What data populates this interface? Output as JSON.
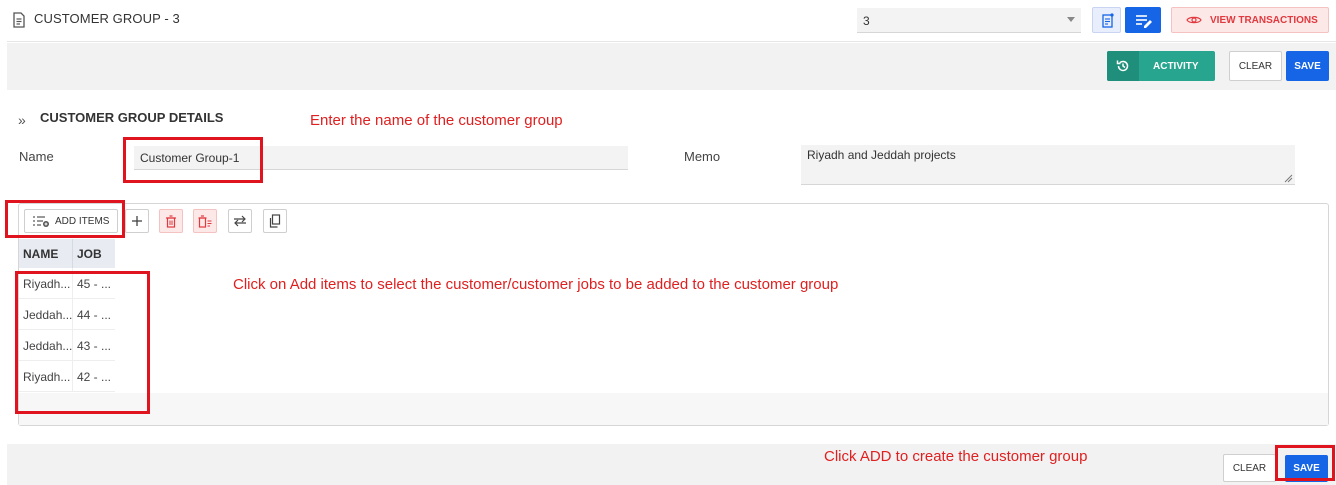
{
  "header": {
    "title": "CUSTOMER GROUP - 3",
    "record_select_value": "3",
    "view_transactions_label": "VIEW TRANSACTIONS"
  },
  "actions": {
    "activity_label": "ACTIVITY",
    "clear_label": "CLEAR",
    "save_label": "SAVE"
  },
  "section": {
    "title": "CUSTOMER GROUP DETAILS",
    "name_label": "Name",
    "name_value": "Customer Group-1",
    "memo_label": "Memo",
    "memo_value": "Riyadh and Jeddah projects"
  },
  "grid": {
    "add_items_label": "ADD ITEMS",
    "columns": [
      "NAME",
      "JOB"
    ],
    "rows": [
      [
        "Riyadh...",
        "45 - ..."
      ],
      [
        "Jeddah...",
        "44 - ..."
      ],
      [
        "Jeddah...",
        "43 - ..."
      ],
      [
        "Riyadh...",
        "42 - ..."
      ]
    ]
  },
  "footer": {
    "clear_label": "CLEAR",
    "save_label": "SAVE"
  },
  "annotations": {
    "name_hint": "Enter the name of the customer group",
    "add_items_hint": "Click on Add items to select the customer/customer jobs to be added to the customer group",
    "save_hint": "Click ADD to create the customer group"
  },
  "colors": {
    "primary": "#1565e6",
    "activity": "#27a58f",
    "danger": "#e0393e",
    "annotation": "#e02020"
  }
}
